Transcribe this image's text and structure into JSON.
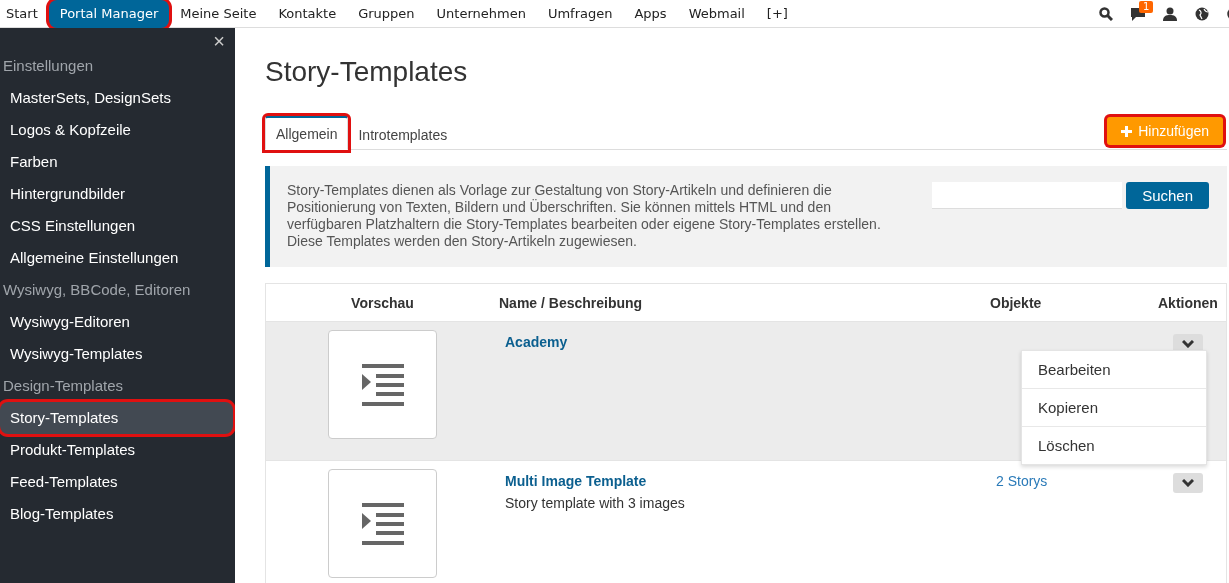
{
  "top_nav": {
    "items": [
      {
        "label": "Start",
        "selected": false,
        "highlighted": false
      },
      {
        "label": "Portal Manager",
        "selected": true,
        "highlighted": true
      },
      {
        "label": "Meine Seite",
        "selected": false,
        "highlighted": false
      },
      {
        "label": "Kontakte",
        "selected": false,
        "highlighted": false
      },
      {
        "label": "Gruppen",
        "selected": false,
        "highlighted": false
      },
      {
        "label": "Unternehmen",
        "selected": false,
        "highlighted": false
      },
      {
        "label": "Umfragen",
        "selected": false,
        "highlighted": false
      },
      {
        "label": "Apps",
        "selected": false,
        "highlighted": false
      },
      {
        "label": "Webmail",
        "selected": false,
        "highlighted": false
      },
      {
        "label": "[+]",
        "selected": false,
        "highlighted": false
      }
    ],
    "notification_badge": "1"
  },
  "sidebar": {
    "close": "×",
    "sections": [
      {
        "heading": "Einstellungen",
        "items": [
          {
            "label": "MasterSets, DesignSets",
            "selected": false,
            "highlighted": false
          },
          {
            "label": "Logos & Kopfzeile",
            "selected": false,
            "highlighted": false
          },
          {
            "label": "Farben",
            "selected": false,
            "highlighted": false
          },
          {
            "label": "Hintergrundbilder",
            "selected": false,
            "highlighted": false
          },
          {
            "label": "CSS Einstellungen",
            "selected": false,
            "highlighted": false
          },
          {
            "label": "Allgemeine Einstellungen",
            "selected": false,
            "highlighted": false
          }
        ]
      },
      {
        "heading": "Wysiwyg, BBCode, Editoren",
        "items": [
          {
            "label": "Wysiwyg-Editoren",
            "selected": false,
            "highlighted": false
          },
          {
            "label": "Wysiwyg-Templates",
            "selected": false,
            "highlighted": false
          }
        ]
      },
      {
        "heading": "Design-Templates",
        "items": [
          {
            "label": "Story-Templates",
            "selected": true,
            "highlighted": true
          },
          {
            "label": "Produkt-Templates",
            "selected": false,
            "highlighted": false
          },
          {
            "label": "Feed-Templates",
            "selected": false,
            "highlighted": false
          },
          {
            "label": "Blog-Templates",
            "selected": false,
            "highlighted": false
          }
        ]
      }
    ]
  },
  "page": {
    "title": "Story-Templates"
  },
  "tabs": [
    {
      "label": "Allgemein",
      "selected": true,
      "highlighted": true
    },
    {
      "label": "Introtemplates",
      "selected": false,
      "highlighted": false
    }
  ],
  "add_button": {
    "label": "Hinzufügen",
    "highlighted": true
  },
  "info": {
    "text": "Story-Templates dienen als Vorlage zur Gestaltung von Story-Artikeln und definieren die Positionierung von Texten, Bildern und Überschriften. Sie können mittels HTML und den verfügbaren Platzhaltern die Story-Templates bearbeiten oder eigene Story-Templates erstellen. Diese Templates werden den Story-Artikeln zugewiesen.",
    "search_button": "Suchen"
  },
  "table": {
    "columns": [
      "Vorschau",
      "Name / Beschreibung",
      "Objekte",
      "Aktionen"
    ],
    "rows": [
      {
        "name": "Academy",
        "selected": true,
        "menu_open": true
      },
      {
        "name": "Multi Image Template",
        "description": "Story template with 3 images",
        "objects": "2 Storys",
        "selected": false,
        "menu_open": false
      }
    ]
  },
  "action_menu": {
    "items": [
      "Bearbeiten",
      "Kopieren",
      "Löschen"
    ]
  }
}
